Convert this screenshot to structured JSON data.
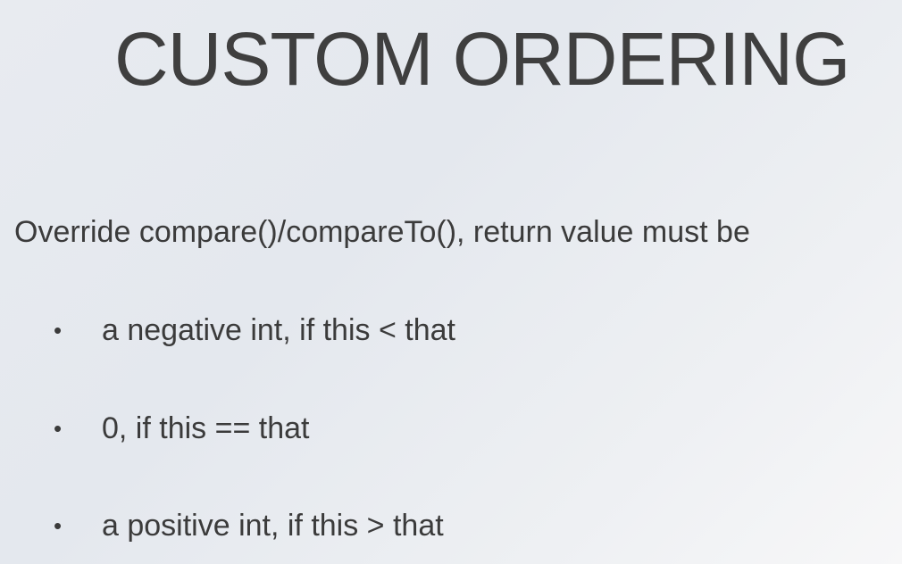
{
  "slide": {
    "title": "CUSTOM ORDERING",
    "lead": "Override compare()/compareTo(), return value must be",
    "bullet_symbol": "•",
    "bullets": [
      "a negative int, if this < that",
      "0, if this == that",
      "a positive int, if this > that"
    ]
  }
}
